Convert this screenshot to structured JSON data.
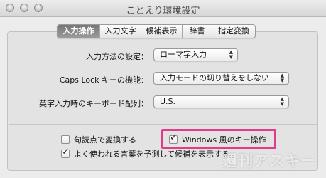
{
  "window": {
    "title": "ことえり環境設定"
  },
  "tabs": [
    {
      "label": "入力操作",
      "active": true
    },
    {
      "label": "入力文字",
      "active": false
    },
    {
      "label": "候補表示",
      "active": false
    },
    {
      "label": "辞書",
      "active": false
    },
    {
      "label": "指定変換",
      "active": false
    }
  ],
  "settings": {
    "input_method": {
      "label": "入力方法の設定：",
      "value": "ローマ字入力"
    },
    "caps_lock": {
      "label": "Caps Lock キーの機能：",
      "value": "入力モードの切り替えをしない"
    },
    "keyboard_layout": {
      "label": "英字入力時のキーボード配列：",
      "value": "U.S."
    }
  },
  "checkboxes": {
    "punctuation_convert": {
      "label": "句読点で変換する",
      "checked": false
    },
    "windows_keys": {
      "label": "Windows 風のキー操作",
      "checked": true
    },
    "predictive_candidates": {
      "label": "よく使われる言葉を予測して候補を表示する",
      "checked": true
    }
  },
  "icons": {
    "popup_arrows": "up-down-chevron-icon",
    "check": "checkmark-icon"
  },
  "colors": {
    "highlight": "#e33a8a",
    "active_tab": "#7f7f7f"
  },
  "watermark": "週刊アスキー"
}
